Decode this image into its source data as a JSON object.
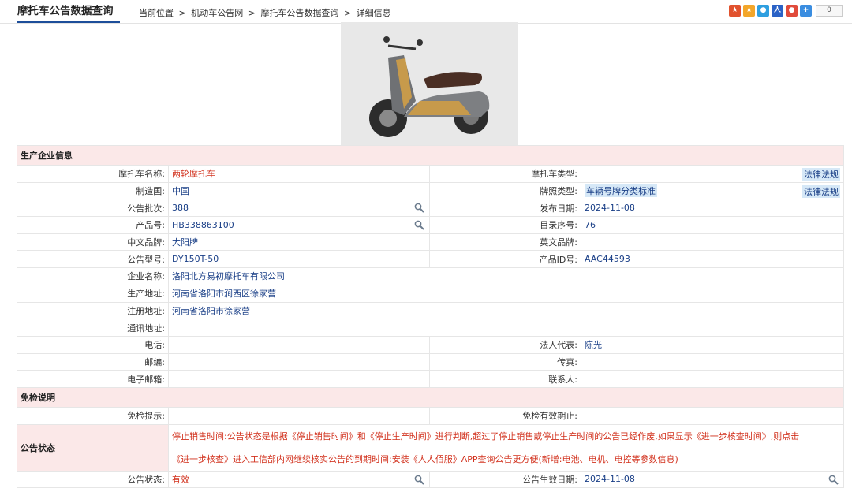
{
  "header": {
    "site_title": "摩托车公告数据查询",
    "breadcrumb": [
      "当前位置",
      ">",
      "机动车公告网",
      ">",
      "摩托车公告数据查询",
      ">",
      "详细信息"
    ],
    "share_count": "0"
  },
  "sections": {
    "company": "生产企业信息",
    "exempt": "免检说明",
    "status": "公告状态"
  },
  "rows": {
    "moto_name_label": "摩托车名称:",
    "moto_name": "两轮摩托车",
    "moto_type_label": "摩托车类型:",
    "moto_type": "",
    "law1": "法律法规",
    "country_label": "制造国:",
    "country": "中国",
    "plate_type_label": "牌照类型:",
    "plate_type": "车辆号牌分类标准",
    "law2": "法律法规",
    "batch_label": "公告批次:",
    "batch": "388",
    "release_date_label": "发布日期:",
    "release_date": "2024-11-08",
    "product_no_label": "产品号:",
    "product_no": "HB338863100",
    "catalog_no_label": "目录序号:",
    "catalog_no": "76",
    "brand_cn_label": "中文品牌:",
    "brand_cn": "大阳牌",
    "brand_en_label": "英文品牌:",
    "brand_en": "",
    "model_label": "公告型号:",
    "model": "DY150T-50",
    "product_id_label": "产品ID号:",
    "product_id": "AAC44593",
    "company_label": "企业名称:",
    "company": "洛阳北方易初摩托车有限公司",
    "prod_addr_label": "生产地址:",
    "prod_addr": "河南省洛阳市涧西区徐家营",
    "reg_addr_label": "注册地址:",
    "reg_addr": "河南省洛阳市徐家营",
    "mail_addr_label": "通讯地址:",
    "mail_addr": "",
    "phone_label": "电话:",
    "phone": "",
    "legal_rep_label": "法人代表:",
    "legal_rep": "陈光",
    "postcode_label": "邮编:",
    "postcode": "",
    "fax_label": "传真:",
    "fax": "",
    "email_label": "电子邮箱:",
    "email": "",
    "contact_label": "联系人:",
    "contact": "",
    "exempt_tip_label": "免检提示:",
    "exempt_tip": "",
    "exempt_valid_label": "免检有效期止:",
    "exempt_valid": "",
    "status_text_1": "停止销售时间:公告状态是根据《停止销售时间》和《停止生产时间》进行判断,超过了停止销售或停止生产时间的公告已经作废,如果显示《进一步核查时间》,则点击",
    "status_text_2": "《进一步核查》进入工信部内网继续核实公告的到期时间:安装《人人佰服》APP查询公告更方便(新增:电池、电机、电控等参数信息)",
    "ann_status_label": "公告状态:",
    "ann_status": "有效",
    "ann_effective_label": "公告生效日期:",
    "ann_effective": "2024-11-08"
  },
  "colors": {
    "section_bg": "#fbe8e8",
    "value_text": "#1a3f87",
    "red_text": "#d2321e",
    "highlight": "#d6e8f7"
  }
}
